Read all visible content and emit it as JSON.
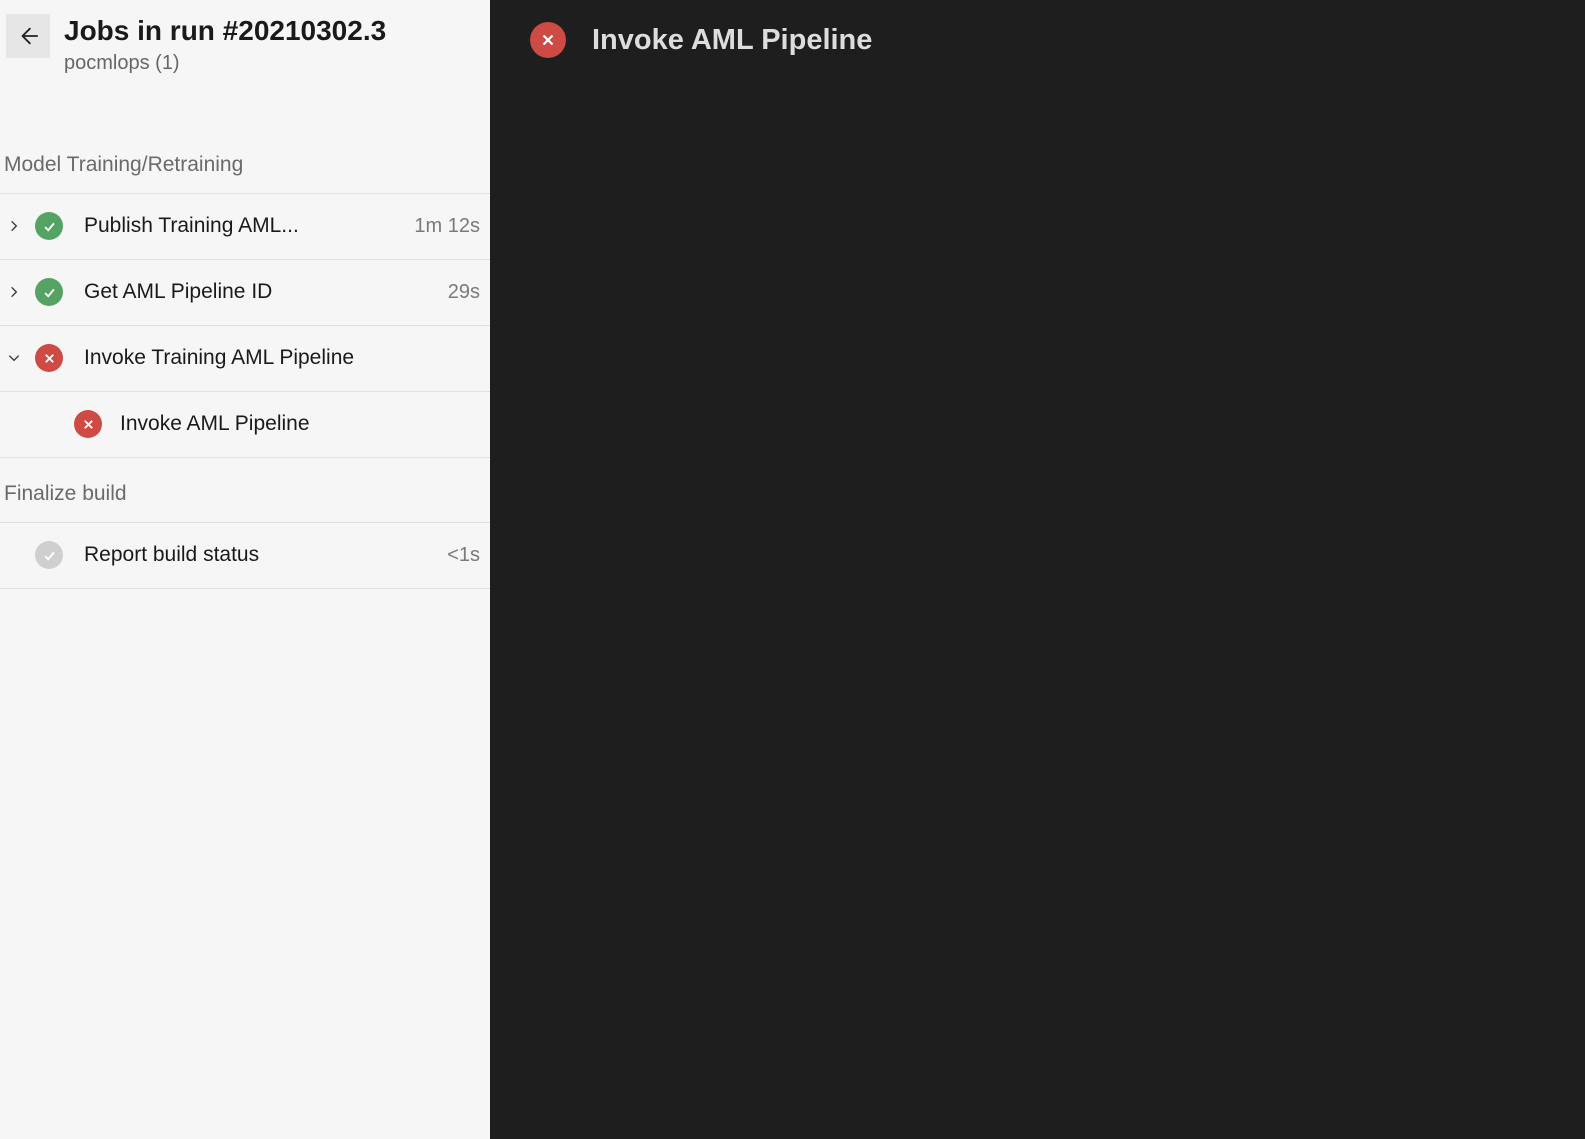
{
  "header": {
    "title": "Jobs in run #20210302.3",
    "subtitle": "pocmlops (1)"
  },
  "sections": [
    {
      "label": "Model Training/Retraining",
      "jobs": [
        {
          "id": "publish-training",
          "name": "Publish Training AML...",
          "status": "success",
          "duration": "1m 12s",
          "expanded": false
        },
        {
          "id": "get-pipeline-id",
          "name": "Get AML Pipeline ID",
          "status": "success",
          "duration": "29s",
          "expanded": false
        },
        {
          "id": "invoke-training",
          "name": "Invoke Training AML Pipeline",
          "status": "failed",
          "duration": "",
          "expanded": true,
          "tasks": [
            {
              "id": "invoke-aml-pipeline",
              "name": "Invoke AML Pipeline",
              "status": "failed"
            }
          ]
        }
      ]
    },
    {
      "label": "Finalize build",
      "jobs": [
        {
          "id": "report-build-status",
          "name": "Report build status",
          "status": "skipped",
          "duration": "<1s",
          "expanded": false
        }
      ]
    }
  ],
  "main": {
    "title": "Invoke AML Pipeline",
    "status": "failed"
  }
}
